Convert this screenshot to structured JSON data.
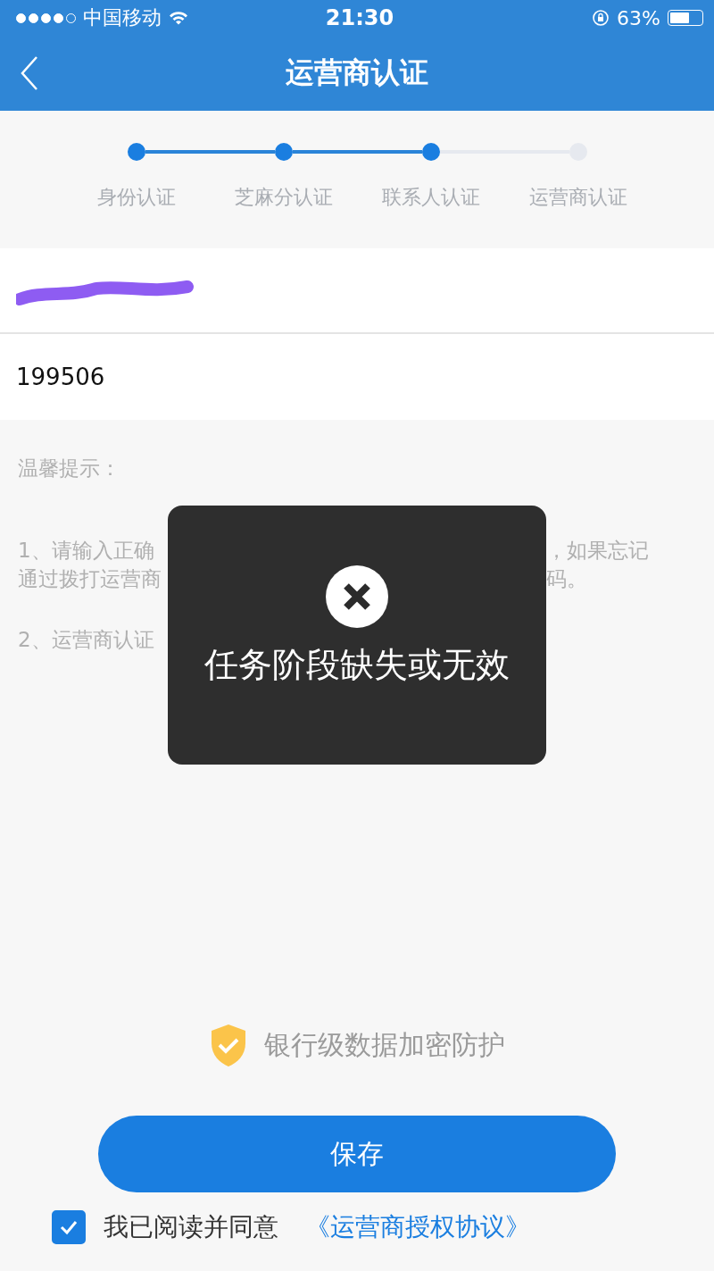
{
  "status_bar": {
    "carrier": "中国移动",
    "time": "21:30",
    "battery_text": "63%",
    "battery": {
      "level": 0.63
    }
  },
  "nav": {
    "title": "运营商认证"
  },
  "steps": [
    {
      "label": "身份认证",
      "done": true
    },
    {
      "label": "芝麻分认证",
      "done": true
    },
    {
      "label": "联系人认证",
      "done": true
    },
    {
      "label": "运营商认证",
      "done": false
    }
  ],
  "fields": [
    {
      "kind": "redacted"
    },
    {
      "kind": "text",
      "value": "199506"
    }
  ],
  "tips": {
    "title": "温馨提示：",
    "items": [
      {
        "lines": [
          {
            "left": "1、请输入正确",
            "right": "，如果忘记"
          },
          {
            "left": "通过拨打运营商",
            "right": "码。"
          }
        ]
      },
      {
        "lines": [
          {
            "left": "2、运营商认证"
          }
        ]
      }
    ]
  },
  "security_note": "银行级数据加密防护",
  "save_button": "保存",
  "agreement": {
    "checked": true,
    "text": "我已阅读并同意",
    "link": "《运营商授权协议》"
  },
  "toast": {
    "kind": "error",
    "message": "任务阶段缺失或无效"
  }
}
